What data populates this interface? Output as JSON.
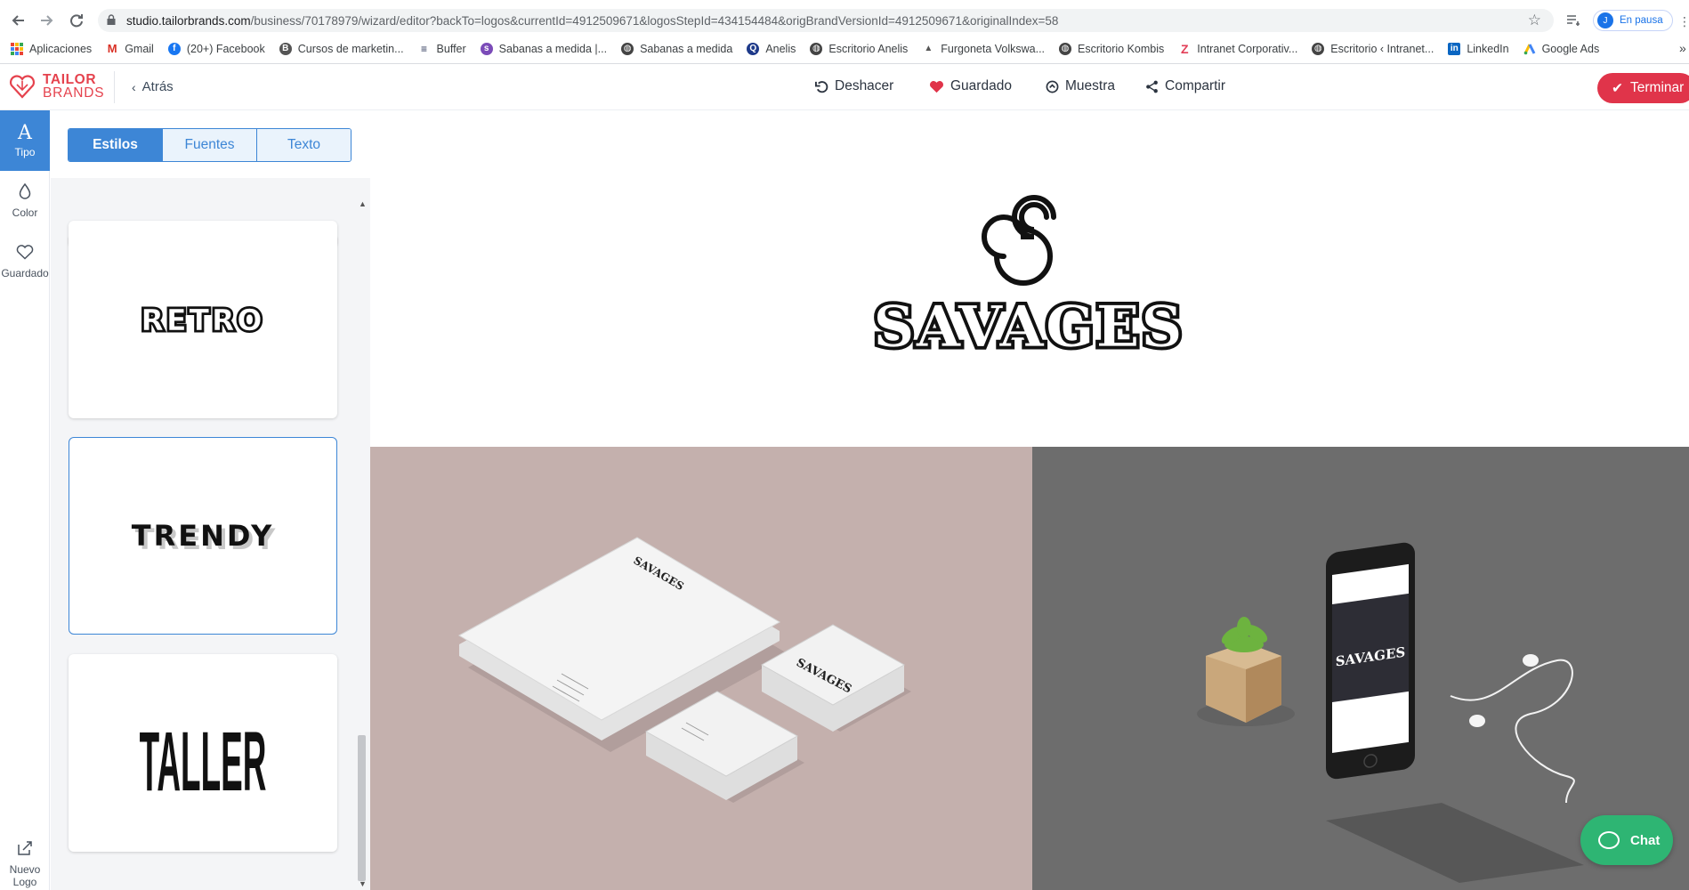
{
  "browser": {
    "url_host": "studio.tailorbrands.com",
    "url_path": "/business/70178979/wizard/editor?backTo=logos&currentId=4912509671&logosStepId=434154484&origBrandVersionId=4912509671&originalIndex=58",
    "profile_initial": "J",
    "profile_status": "En pausa",
    "bookmarks": [
      {
        "label": "Aplicaciones",
        "icon": "apps-grid-icon"
      },
      {
        "label": "Gmail",
        "icon": "gmail-icon",
        "color": "#d93025"
      },
      {
        "label": "(20+) Facebook",
        "icon": "facebook-icon",
        "color": "#1877f2"
      },
      {
        "label": "Cursos de marketin...",
        "icon": "b-circle-icon",
        "color": "#555555"
      },
      {
        "label": "Buffer",
        "icon": "buffer-icon",
        "color": "#2a3557"
      },
      {
        "label": "Sabanas a medida |...",
        "icon": "sabanas-icon",
        "color": "#7b4bb8"
      },
      {
        "label": "Sabanas a medida",
        "icon": "globe-icon",
        "color": "#444444"
      },
      {
        "label": "Anelis",
        "icon": "anelis-icon",
        "color": "#1e3a8a"
      },
      {
        "label": "Escritorio Anelis",
        "icon": "globe-icon",
        "color": "#444444"
      },
      {
        "label": "Furgoneta Volkswa...",
        "icon": "van-icon",
        "color": "#555555"
      },
      {
        "label": "Escritorio Kombis",
        "icon": "globe-icon",
        "color": "#444444"
      },
      {
        "label": "Intranet Corporativ...",
        "icon": "z-icon",
        "color": "#e23e57"
      },
      {
        "label": "Escritorio ‹ Intranet...",
        "icon": "globe-icon",
        "color": "#444444"
      },
      {
        "label": "LinkedIn",
        "icon": "linkedin-icon",
        "color": "#0a66c2"
      },
      {
        "label": "Google Ads",
        "icon": "google-ads-icon",
        "color": "#fbbc04"
      }
    ]
  },
  "header": {
    "brand_line1": "TAILOR",
    "brand_line2": "BRANDS",
    "back_label": "Atrás",
    "undo_label": "Deshacer",
    "saved_label": "Guardado",
    "preview_label": "Muestra",
    "share_label": "Compartir",
    "finish_label": "Terminar",
    "accent_color": "#e0344a"
  },
  "rail": {
    "items": [
      {
        "label": "Tipo",
        "icon": "type-a-icon",
        "active": true
      },
      {
        "label": "Color",
        "icon": "drop-icon",
        "active": false
      },
      {
        "label": "Guardado",
        "icon": "heart-outline-icon",
        "active": false
      }
    ],
    "new_logo_line1": "Nuevo",
    "new_logo_line2": "Logo"
  },
  "panel": {
    "tabs": [
      "Estilos",
      "Fuentes",
      "Texto"
    ],
    "active_tab": "Estilos",
    "styles": [
      "RETRO",
      "TRENDY",
      "TALLER"
    ],
    "selected_style": "TRENDY"
  },
  "canvas": {
    "logo_text": "SAVAGES",
    "mockup_logo_text": "SAVAGES"
  },
  "chat": {
    "label": "Chat",
    "color": "#2eb573"
  }
}
